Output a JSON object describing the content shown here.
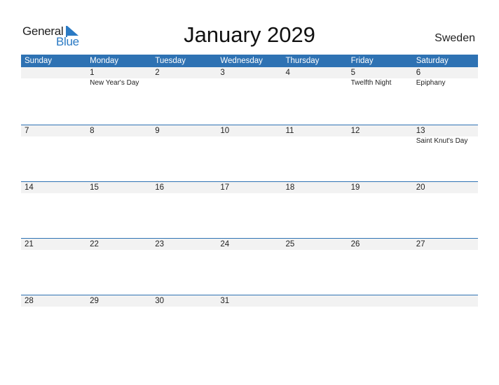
{
  "logo": {
    "text_general": "General",
    "text_blue": "Blue",
    "icon": "blue-triangle-flag-icon",
    "accent": "#2a7ac4"
  },
  "title": "January 2029",
  "country": "Sweden",
  "colors": {
    "header_bg": "#2e72b3",
    "header_text": "#ffffff",
    "date_row_bg": "#f2f2f2"
  },
  "weekdays": [
    "Sunday",
    "Monday",
    "Tuesday",
    "Wednesday",
    "Thursday",
    "Friday",
    "Saturday"
  ],
  "weeks": [
    {
      "days": [
        "",
        "1",
        "2",
        "3",
        "4",
        "5",
        "6"
      ],
      "events": [
        "",
        "New Year's Day",
        "",
        "",
        "",
        "Twelfth Night",
        "Epiphany"
      ]
    },
    {
      "days": [
        "7",
        "8",
        "9",
        "10",
        "11",
        "12",
        "13"
      ],
      "events": [
        "",
        "",
        "",
        "",
        "",
        "",
        "Saint Knut's Day"
      ]
    },
    {
      "days": [
        "14",
        "15",
        "16",
        "17",
        "18",
        "19",
        "20"
      ],
      "events": [
        "",
        "",
        "",
        "",
        "",
        "",
        ""
      ]
    },
    {
      "days": [
        "21",
        "22",
        "23",
        "24",
        "25",
        "26",
        "27"
      ],
      "events": [
        "",
        "",
        "",
        "",
        "",
        "",
        ""
      ]
    },
    {
      "days": [
        "28",
        "29",
        "30",
        "31",
        "",
        "",
        ""
      ],
      "events": [
        "",
        "",
        "",
        "",
        "",
        "",
        ""
      ]
    }
  ]
}
